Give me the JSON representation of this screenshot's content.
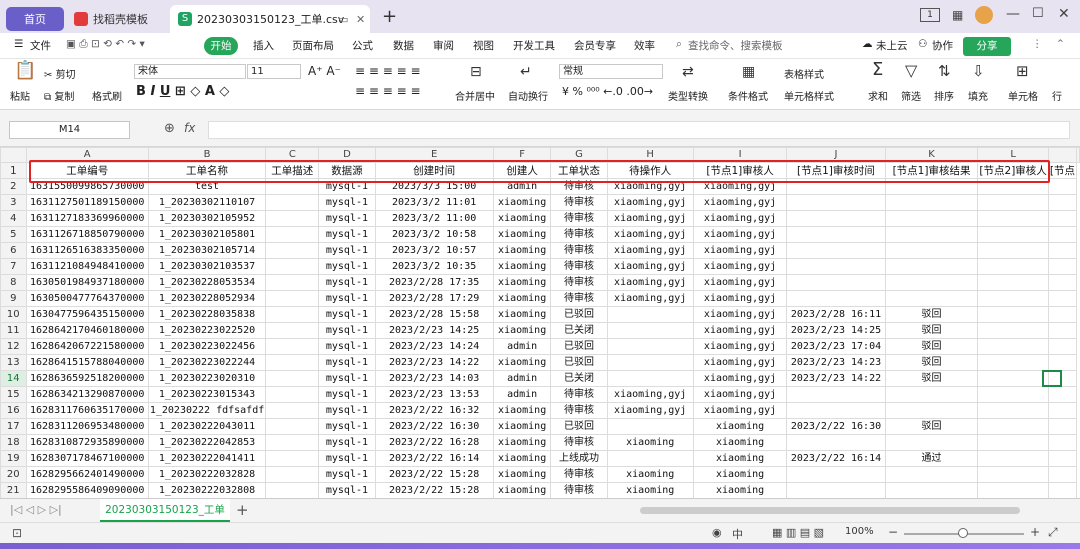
{
  "tabs": {
    "home": "首页",
    "template": "找稻壳模板",
    "file": "20230303150123_工单.csv"
  },
  "window_badge": "1",
  "menu": {
    "file": "文件",
    "start": "开始",
    "items": [
      "插入",
      "页面布局",
      "公式",
      "数据",
      "审阅",
      "视图",
      "开发工具",
      "会员专享",
      "效率"
    ],
    "search_placeholder": "查找命令、搜索模板",
    "cloud": "未上云",
    "collab": "协作",
    "share": "分享"
  },
  "ribbon": {
    "cut": "剪切",
    "paste": "粘贴",
    "copy": "复制",
    "format_painter": "格式刷",
    "font": "宋体",
    "size": "11",
    "merge": "合并居中",
    "wrap": "自动换行",
    "number_format": "常规",
    "type_convert": "类型转换",
    "cond_format": "条件格式",
    "table_style": "表格样式",
    "cell_style": "单元格样式",
    "sum": "求和",
    "filter": "筛选",
    "sort": "排序",
    "fill": "填充",
    "cell": "单元格",
    "row": "行"
  },
  "name_box": "M14",
  "fx": "fx",
  "col_letters": [
    "A",
    "B",
    "C",
    "D",
    "E",
    "F",
    "G",
    "H",
    "I",
    "J",
    "K",
    "L"
  ],
  "headers": [
    "工单编号",
    "工单名称",
    "工单描述",
    "数据源",
    "创建时间",
    "创建人",
    "工单状态",
    "待操作人",
    "[节点1]审核人",
    "[节点1]审核时间",
    "[节点1]审核结果",
    "[节点2]审核人",
    "[节点"
  ],
  "rows": [
    [
      "1631550099865730000",
      "test",
      "",
      "mysql-1",
      "2023/3/3 15:00",
      "admin",
      "待审核",
      "xiaoming,gyj",
      "xiaoming,gyj",
      "",
      "",
      "",
      ""
    ],
    [
      "1631127501189150000",
      "1_20230302110107",
      "",
      "mysql-1",
      "2023/3/2 11:01",
      "xiaoming",
      "待审核",
      "xiaoming,gyj",
      "xiaoming,gyj",
      "",
      "",
      "",
      ""
    ],
    [
      "1631127183369960000",
      "1_20230302105952",
      "",
      "mysql-1",
      "2023/3/2 11:00",
      "xiaoming",
      "待审核",
      "xiaoming,gyj",
      "xiaoming,gyj",
      "",
      "",
      "",
      ""
    ],
    [
      "1631126718850790000",
      "1_20230302105801",
      "",
      "mysql-1",
      "2023/3/2 10:58",
      "xiaoming",
      "待审核",
      "xiaoming,gyj",
      "xiaoming,gyj",
      "",
      "",
      "",
      ""
    ],
    [
      "1631126516383350000",
      "1_20230302105714",
      "",
      "mysql-1",
      "2023/3/2 10:57",
      "xiaoming",
      "待审核",
      "xiaoming,gyj",
      "xiaoming,gyj",
      "",
      "",
      "",
      ""
    ],
    [
      "1631121084948410000",
      "1_20230302103537",
      "",
      "mysql-1",
      "2023/3/2 10:35",
      "xiaoming",
      "待审核",
      "xiaoming,gyj",
      "xiaoming,gyj",
      "",
      "",
      "",
      ""
    ],
    [
      "1630501984937180000",
      "1_20230228053534",
      "",
      "mysql-1",
      "2023/2/28 17:35",
      "xiaoming",
      "待审核",
      "xiaoming,gyj",
      "xiaoming,gyj",
      "",
      "",
      "",
      ""
    ],
    [
      "1630500477764370000",
      "1_20230228052934",
      "",
      "mysql-1",
      "2023/2/28 17:29",
      "xiaoming",
      "待审核",
      "xiaoming,gyj",
      "xiaoming,gyj",
      "",
      "",
      "",
      ""
    ],
    [
      "1630477596435150000",
      "1_20230228035838",
      "",
      "mysql-1",
      "2023/2/28 15:58",
      "xiaoming",
      "已驳回",
      "",
      "xiaoming,gyj",
      "2023/2/28 16:11",
      "驳回",
      "",
      ""
    ],
    [
      "1628642170460180000",
      "1_20230223022520",
      "",
      "mysql-1",
      "2023/2/23 14:25",
      "xiaoming",
      "已关闭",
      "",
      "xiaoming,gyj",
      "2023/2/23 14:25",
      "驳回",
      "",
      ""
    ],
    [
      "1628642067221580000",
      "1_20230223022456",
      "",
      "mysql-1",
      "2023/2/23 14:24",
      "admin",
      "已驳回",
      "",
      "xiaoming,gyj",
      "2023/2/23 17:04",
      "驳回",
      "",
      ""
    ],
    [
      "1628641515788040000",
      "1_20230223022244",
      "",
      "mysql-1",
      "2023/2/23 14:22",
      "xiaoming",
      "已驳回",
      "",
      "xiaoming,gyj",
      "2023/2/23 14:23",
      "驳回",
      "",
      ""
    ],
    [
      "1628636592518200000",
      "1_20230223020310",
      "",
      "mysql-1",
      "2023/2/23 14:03",
      "admin",
      "已关闭",
      "",
      "xiaoming,gyj",
      "2023/2/23 14:22",
      "驳回",
      "",
      ""
    ],
    [
      "1628634213290870000",
      "1_20230223015343",
      "",
      "mysql-1",
      "2023/2/23 13:53",
      "admin",
      "待审核",
      "xiaoming,gyj",
      "xiaoming,gyj",
      "",
      "",
      "",
      ""
    ],
    [
      "1628311760635170000",
      "1_20230222 fdfsafdf",
      "",
      "mysql-1",
      "2023/2/22 16:32",
      "xiaoming",
      "待审核",
      "xiaoming,gyj",
      "xiaoming,gyj",
      "",
      "",
      "",
      ""
    ],
    [
      "1628311206953480000",
      "1_20230222043011",
      "",
      "mysql-1",
      "2023/2/22 16:30",
      "xiaoming",
      "已驳回",
      "",
      "xiaoming",
      "2023/2/22 16:30",
      "驳回",
      "",
      ""
    ],
    [
      "1628310872935890000",
      "1_20230222042853",
      "",
      "mysql-1",
      "2023/2/22 16:28",
      "xiaoming",
      "待审核",
      "xiaoming",
      "xiaoming",
      "",
      "",
      "",
      ""
    ],
    [
      "1628307178467100000",
      "1_20230222041411",
      "",
      "mysql-1",
      "2023/2/22 16:14",
      "xiaoming",
      "上线成功",
      "",
      "xiaoming",
      "2023/2/22 16:14",
      "通过",
      "",
      ""
    ],
    [
      "1628295662401490000",
      "1_20230222032828",
      "",
      "mysql-1",
      "2023/2/22 15:28",
      "xiaoming",
      "待审核",
      "xiaoming",
      "xiaoming",
      "",
      "",
      "",
      ""
    ],
    [
      "1628295586409090000",
      "1_20230222032808",
      "",
      "mysql-1",
      "2023/2/22 15:28",
      "xiaoming",
      "待审核",
      "xiaoming",
      "xiaoming",
      "",
      "",
      "",
      ""
    ]
  ],
  "sheet_tab": "20230303150123_工单",
  "status": {
    "zoom": "100%",
    "ime": "中"
  }
}
